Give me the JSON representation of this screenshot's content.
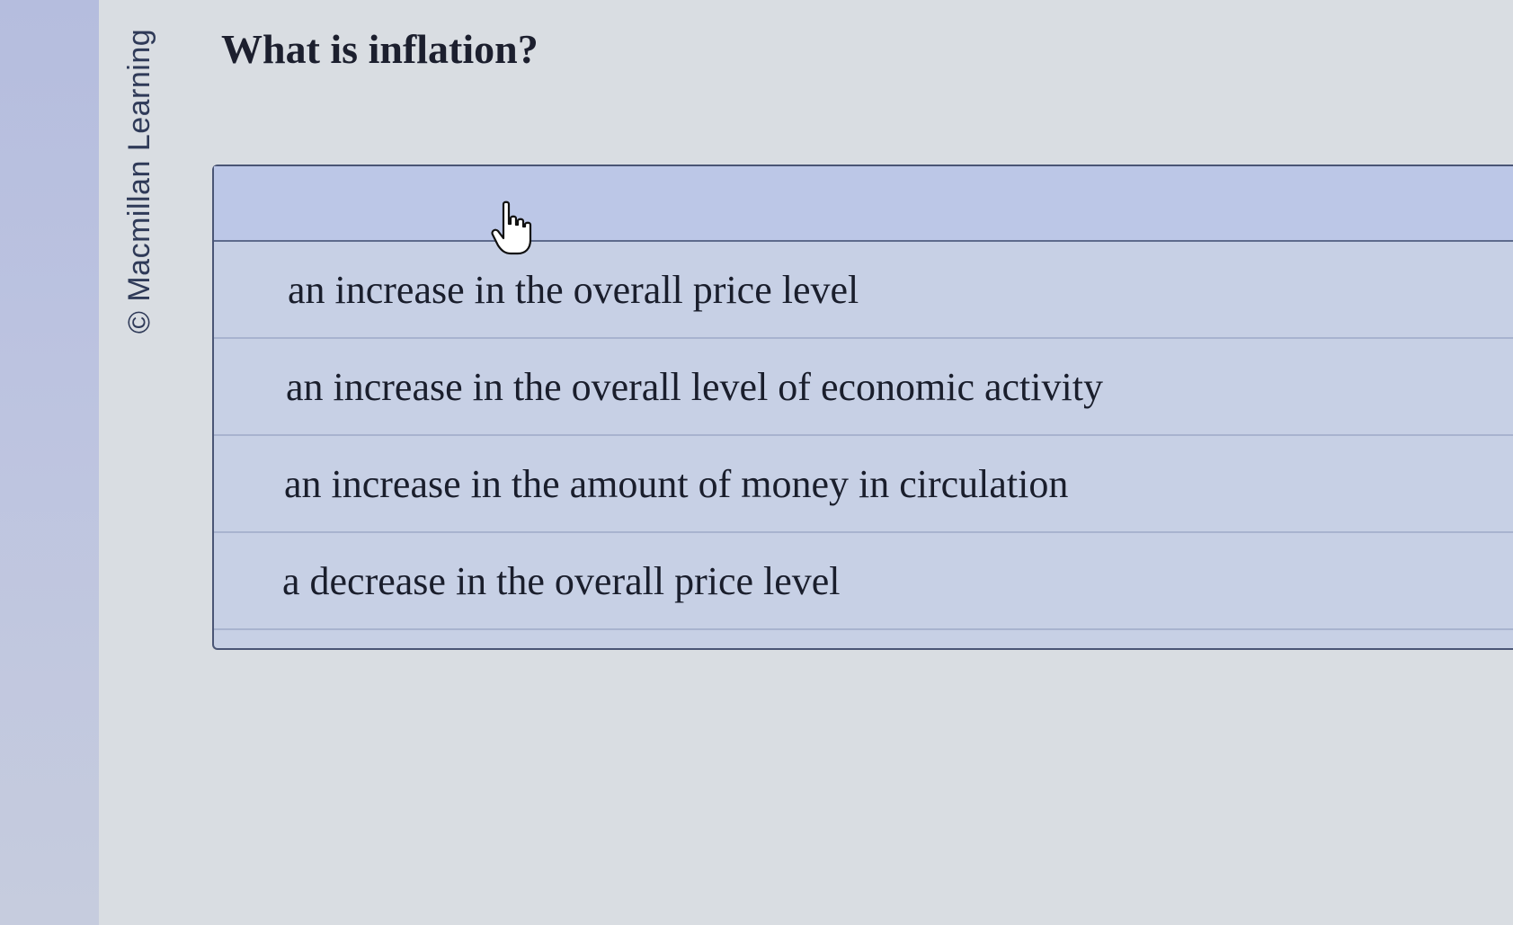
{
  "credit": "© Macmillan Learning",
  "question": "What is inflation?",
  "choices": [
    {
      "label": "an increase in the overall price level"
    },
    {
      "label": "an increase in the overall level of economic activity"
    },
    {
      "label": "an increase in the amount of money in circulation"
    },
    {
      "label": "a decrease in the overall price level"
    }
  ],
  "colors": {
    "accent_border": "#4a5575",
    "choice_background": "#c7d0e5"
  },
  "cursor": "hand-pointer-icon"
}
